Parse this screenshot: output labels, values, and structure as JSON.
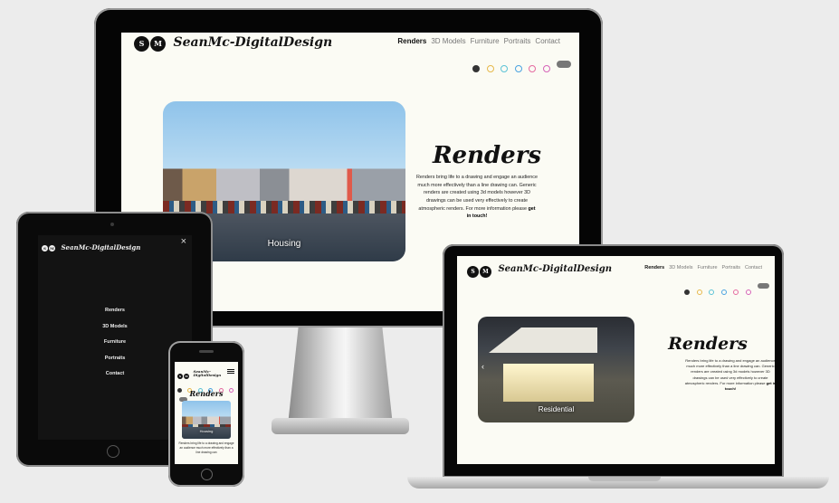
{
  "site": {
    "logo_badge": "S M",
    "logo_text": "SeanMc-DigitalDesign",
    "nav": [
      "Renders",
      "3D Models",
      "Furniture",
      "Portraits",
      "Contact"
    ],
    "active_nav": "Renders",
    "theme_dots": [
      "#333333",
      "#e6b84a",
      "#5cc3d6",
      "#4aa3e0",
      "#e56aa0",
      "#d663b8"
    ],
    "heading": "Renders",
    "desc_desktop": "Renders bring life to a drawing and engage an audience much more effectively than a line drawing can. Generic renders are created using 3d models however 3D drawings can be used very effectively to create atmospheric renders. For more information please",
    "desc_laptop": "Renders bring life to a drawing and engage an audience much more effectively than a line drawing can. Generic renders are created using 3d models however 3D drawings can be used very effectively to create atmospheric renders. For more information please",
    "cta": "get in touch!",
    "slides": {
      "desktop_caption": "Housing",
      "laptop_caption": "Residential",
      "phone_caption": "Housing"
    },
    "mobile_menu": [
      "Renders",
      "3D Models",
      "Furniture",
      "Portraits",
      "Contact"
    ],
    "close_symbol": "×",
    "phone_desc": "Renders bring life to a drawing and engage an audience much more effectively than a line drawing can"
  },
  "icons": {
    "close": "close-icon",
    "menu": "hamburger-menu-icon",
    "logo": "logo-gear-icon"
  }
}
